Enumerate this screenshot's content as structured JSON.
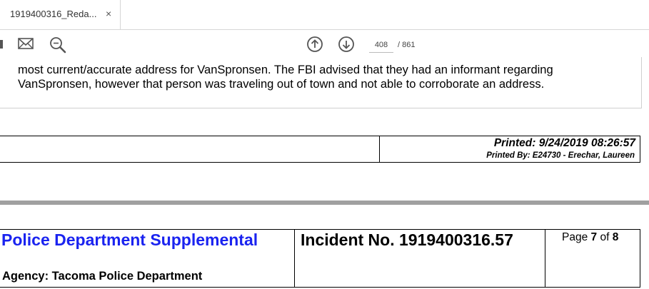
{
  "tab": {
    "title": "1919400316_Reda...",
    "close": "×"
  },
  "toolbar": {
    "current_page": "408",
    "total_pages": "/ 861"
  },
  "narrative": {
    "lines": [
      "most current/accurate address for VanSpronsen.  The FBI advised that they had an informant regarding",
      "VanSpronsen, however that person was traveling out of town and not able to corroborate an address."
    ]
  },
  "printed": {
    "label": "Printed: 9/24/2019 08:26:57",
    "by": "Printed By: E24730 - Erechar, Laureen"
  },
  "header": {
    "department": "Police Department Supplemental",
    "agency": "Agency: Tacoma Police Department",
    "incident": "Incident No. 1919400316.57",
    "page_prefix": "Page ",
    "page_num": "7",
    "page_of": " of ",
    "page_total": "8"
  }
}
